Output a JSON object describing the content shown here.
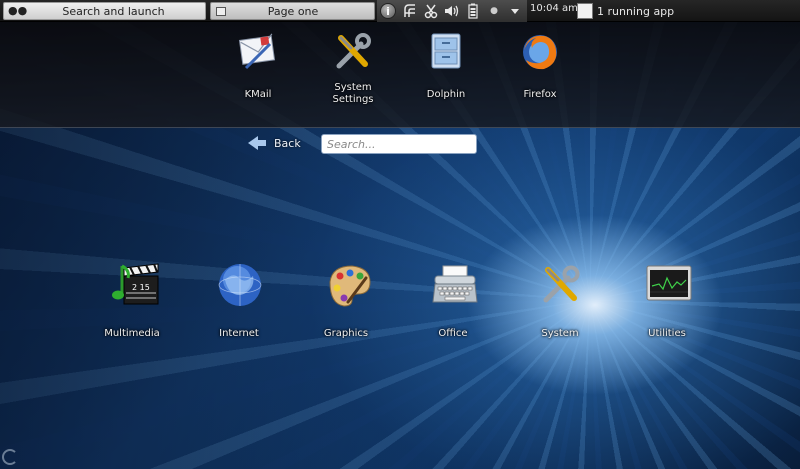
{
  "top_panel": {
    "launcher_label": "Search and launch",
    "page_label": "Page one",
    "clock": "10:04 am",
    "running_apps": "1 running app",
    "tray_icons": [
      "info-icon",
      "network-icon",
      "clipboard-icon",
      "volume-icon",
      "battery-icon",
      "notification-dot",
      "expand-arrow-icon"
    ]
  },
  "favorites": [
    {
      "label": "KMail",
      "icon": "mail-icon"
    },
    {
      "label": "System\nSettings",
      "icon": "settings-icon"
    },
    {
      "label": "Dolphin",
      "icon": "file-manager-icon"
    },
    {
      "label": "Firefox",
      "icon": "firefox-icon"
    }
  ],
  "nav": {
    "back_label": "Back",
    "search_placeholder": "Search..."
  },
  "categories": [
    {
      "label": "Multimedia",
      "icon": "multimedia-icon"
    },
    {
      "label": "Internet",
      "icon": "globe-icon"
    },
    {
      "label": "Graphics",
      "icon": "palette-icon"
    },
    {
      "label": "Office",
      "icon": "typewriter-icon"
    },
    {
      "label": "System",
      "icon": "tools-icon"
    },
    {
      "label": "Utilities",
      "icon": "monitor-icon"
    }
  ]
}
